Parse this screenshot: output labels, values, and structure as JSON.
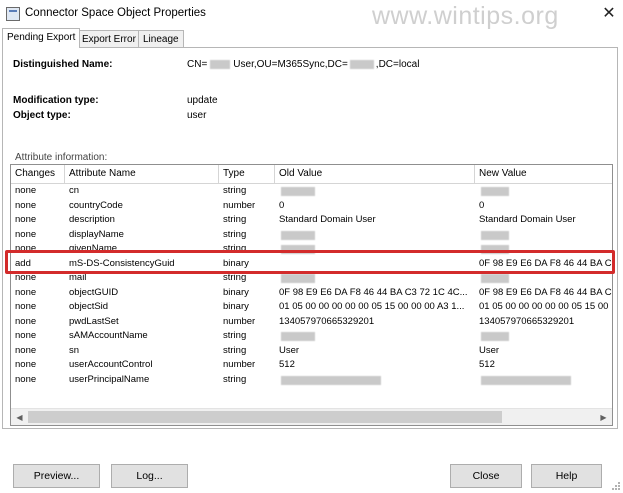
{
  "window": {
    "title": "Connector Space Object Properties",
    "close_glyph": "✕"
  },
  "watermark": "www.wintips.org",
  "tabs": [
    {
      "label": "Pending Export"
    },
    {
      "label": "Export Error"
    },
    {
      "label": "Lineage"
    }
  ],
  "details": {
    "dn_label": "Distinguished Name:",
    "dn_prefix": "CN=",
    "dn_mid": "User,OU=M365Sync,DC=",
    "dn_suffix": ",DC=local",
    "mod_label": "Modification type:",
    "mod_value": "update",
    "objtype_label": "Object type:",
    "objtype_value": "user",
    "attr_info_label": "Attribute information:"
  },
  "grid": {
    "columns": [
      "Changes",
      "Attribute Name",
      "Type",
      "Old Value",
      "New Value"
    ],
    "rows": [
      {
        "change": "none",
        "attr": "cn",
        "type": "string",
        "old": "",
        "new": ""
      },
      {
        "change": "none",
        "attr": "countryCode",
        "type": "number",
        "old": "0",
        "new": "0"
      },
      {
        "change": "none",
        "attr": "description",
        "type": "string",
        "old": "Standard Domain User",
        "new": "Standard Domain User"
      },
      {
        "change": "none",
        "attr": "displayName",
        "type": "string",
        "old": "",
        "new": ""
      },
      {
        "change": "none",
        "attr": "givenName",
        "type": "string",
        "old": "",
        "new": ""
      },
      {
        "change": "add",
        "attr": "mS-DS-ConsistencyGuid",
        "type": "binary",
        "old": "",
        "new": "0F 98 E9 E6 DA F8 46 44 BA C"
      },
      {
        "change": "none",
        "attr": "mail",
        "type": "string",
        "old": "",
        "new": ""
      },
      {
        "change": "none",
        "attr": "objectGUID",
        "type": "binary",
        "old": "0F 98 E9 E6 DA F8 46 44 BA C3 72 1C 4C...",
        "new": "0F 98 E9 E6 DA F8 46 44 BA C"
      },
      {
        "change": "none",
        "attr": "objectSid",
        "type": "binary",
        "old": "01 05 00 00 00 00 00 05 15 00 00 00 A3 1...",
        "new": "01 05 00 00 00 00 00 05 15 00"
      },
      {
        "change": "none",
        "attr": "pwdLastSet",
        "type": "number",
        "old": "134057970665329201",
        "new": "134057970665329201"
      },
      {
        "change": "none",
        "attr": "sAMAccountName",
        "type": "string",
        "old": "",
        "new": ""
      },
      {
        "change": "none",
        "attr": "sn",
        "type": "string",
        "old": "User",
        "new": "User"
      },
      {
        "change": "none",
        "attr": "userAccountControl",
        "type": "number",
        "old": "512",
        "new": "512"
      },
      {
        "change": "none",
        "attr": "userPrincipalName",
        "type": "string",
        "old": "",
        "new": ""
      }
    ]
  },
  "scrollbar": {
    "left_arrow": "◀",
    "right_arrow": "▶"
  },
  "buttons": {
    "preview": "Preview...",
    "log": "Log...",
    "close": "Close",
    "help": "Help"
  },
  "colors": {
    "highlight": "#d32b2b",
    "selected_row_bg": "#ffffff"
  }
}
